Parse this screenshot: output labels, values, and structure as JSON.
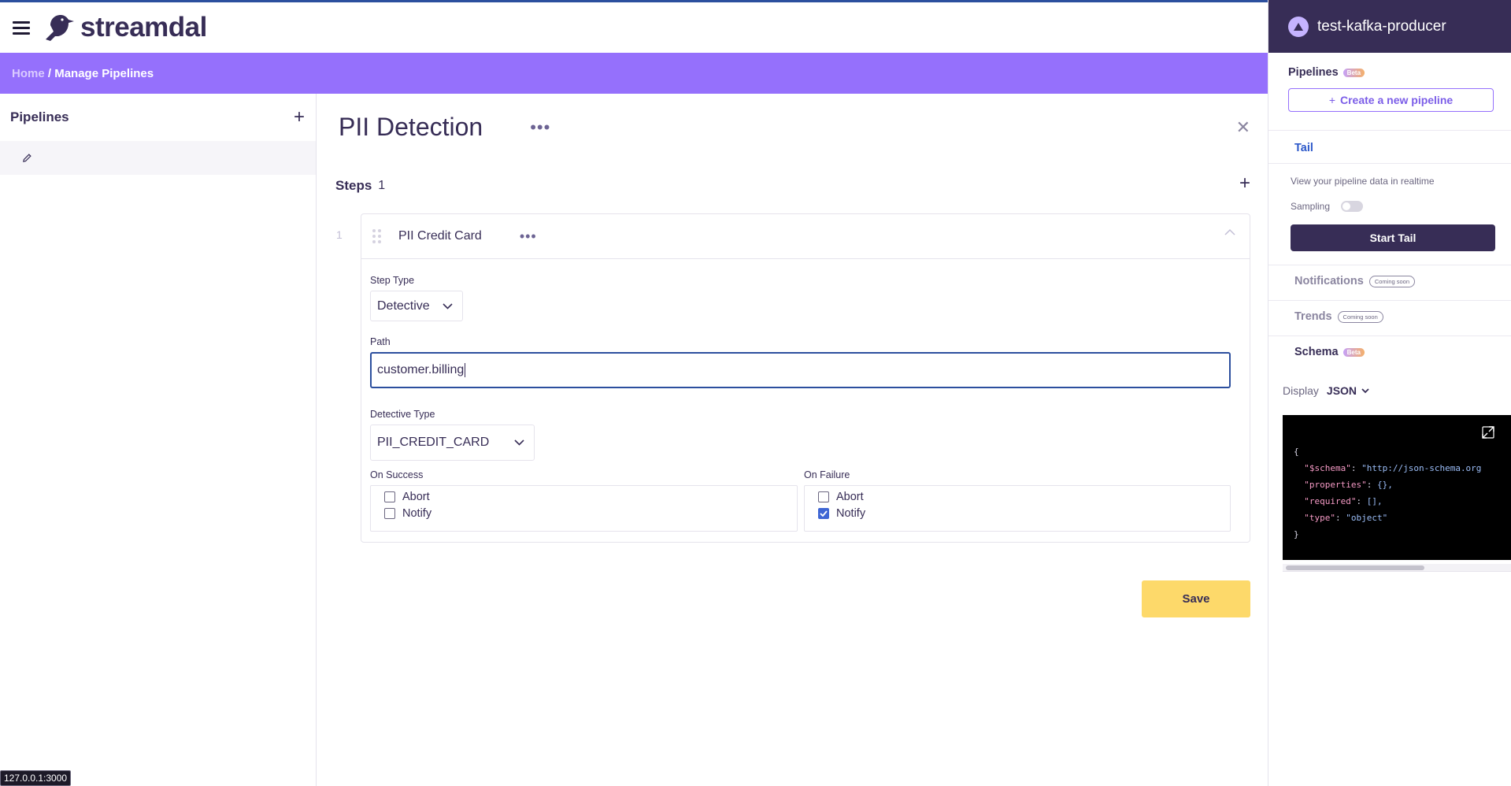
{
  "app": {
    "brand": "streamdal"
  },
  "breadcrumb": {
    "home": "Home",
    "separator": " / ",
    "current": "Manage Pipelines"
  },
  "sidebar": {
    "title": "Pipelines"
  },
  "pipeline": {
    "title": "PII Detection",
    "steps_label": "Steps",
    "steps_count": "1",
    "step": {
      "number": "1",
      "name": "PII Credit Card",
      "step_type_label": "Step Type",
      "step_type_value": "Detective",
      "path_label": "Path",
      "path_value": "customer.billing",
      "detective_type_label": "Detective Type",
      "detective_type_value": "PII_CREDIT_CARD",
      "on_success_label": "On Success",
      "on_failure_label": "On Failure",
      "on_success": [
        {
          "label": "Abort",
          "checked": false
        },
        {
          "label": "Notify",
          "checked": false
        }
      ],
      "on_failure": [
        {
          "label": "Abort",
          "checked": false
        },
        {
          "label": "Notify",
          "checked": true
        }
      ]
    },
    "save_label": "Save"
  },
  "url_tooltip": "127.0.0.1:3000",
  "right_panel": {
    "service_name": "test-kafka-producer",
    "pipelines_title": "Pipelines",
    "beta": "Beta",
    "create_label": "Create a new pipeline",
    "tail_tab": "Tail",
    "tail_description": "View your pipeline data in realtime",
    "sampling_label": "Sampling",
    "sampling_on": false,
    "start_tail_label": "Start Tail",
    "notifications_title": "Notifications",
    "trends_title": "Trends",
    "coming_soon": "Coming soon",
    "schema_title": "Schema",
    "display_label": "Display",
    "display_value": "JSON",
    "schema_lines": [
      "{",
      "  \"$schema\": \"http://json-schema.org",
      "  \"properties\": {},",
      "  \"required\": [],",
      "  \"type\": \"object\"",
      "}"
    ]
  },
  "colors": {
    "accent_purple": "#9570fc",
    "dark_purple": "#372d56",
    "save_yellow": "#fdd96a",
    "focus_blue": "#2c4f9e",
    "checkbox_blue": "#3f66d4"
  }
}
